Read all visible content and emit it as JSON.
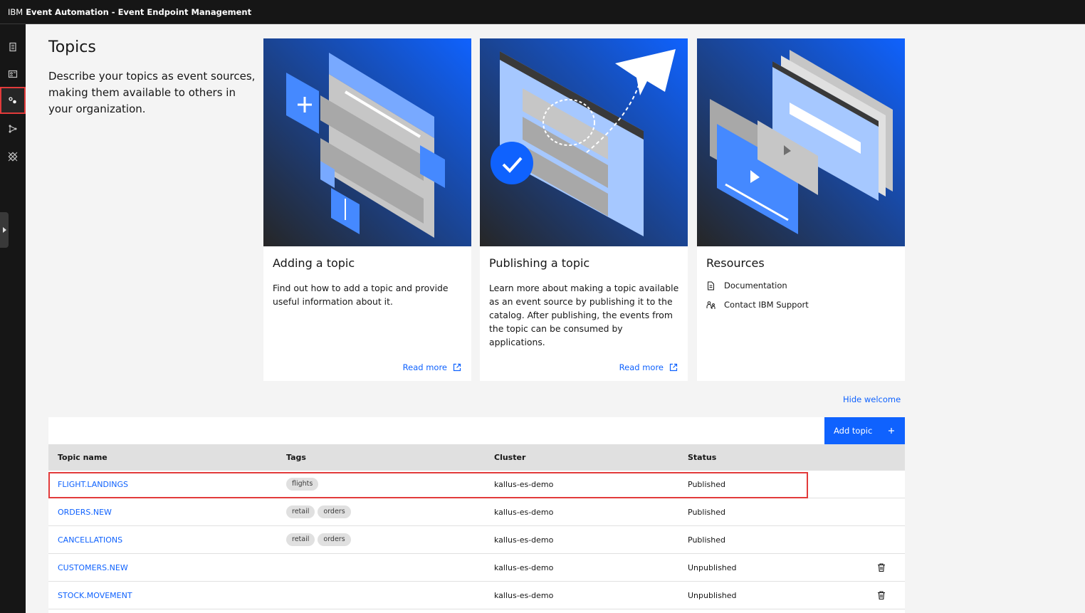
{
  "header": {
    "brand": "IBM",
    "product": "Event Automation - Event Endpoint Management"
  },
  "sidenav": {
    "items": [
      {
        "name": "catalog",
        "icon": "catalog-icon"
      },
      {
        "name": "subscriptions",
        "icon": "id-card-icon"
      },
      {
        "name": "topics",
        "icon": "topics-icon",
        "active": true
      },
      {
        "name": "gateways",
        "icon": "network-icon"
      },
      {
        "name": "admin",
        "icon": "gateway-icon"
      }
    ]
  },
  "welcome": {
    "title": "Topics",
    "description": "Describe your topics as event sources, making them available to others in your organization.",
    "tiles": [
      {
        "title": "Adding a topic",
        "body": "Find out how to add a topic and provide useful information about it.",
        "link": "Read more"
      },
      {
        "title": "Publishing a topic",
        "body": "Learn more about making a topic available as an event source by publishing it to the catalog. After publishing, the events from the topic can be consumed by applications.",
        "link": "Read more"
      },
      {
        "title": "Resources",
        "links": [
          "Documentation",
          "Contact IBM Support"
        ]
      }
    ],
    "hide_label": "Hide welcome"
  },
  "table": {
    "add_label": "Add topic",
    "columns": [
      "Topic name",
      "Tags",
      "Cluster",
      "Status"
    ],
    "rows": [
      {
        "name": "FLIGHT.LANDINGS",
        "tags": [
          "flights"
        ],
        "cluster": "kallus-es-demo",
        "status": "Published",
        "deletable": false
      },
      {
        "name": "ORDERS.NEW",
        "tags": [
          "retail",
          "orders"
        ],
        "cluster": "kallus-es-demo",
        "status": "Published",
        "deletable": false
      },
      {
        "name": "CANCELLATIONS",
        "tags": [
          "retail",
          "orders"
        ],
        "cluster": "kallus-es-demo",
        "status": "Published",
        "deletable": false
      },
      {
        "name": "CUSTOMERS.NEW",
        "tags": [],
        "cluster": "kallus-es-demo",
        "status": "Unpublished",
        "deletable": true
      },
      {
        "name": "STOCK.MOVEMENT",
        "tags": [],
        "cluster": "kallus-es-demo",
        "status": "Unpublished",
        "deletable": true
      }
    ]
  },
  "colors": {
    "accent": "#0f62fe",
    "highlight": "#e23b3b",
    "header": "#161616"
  }
}
